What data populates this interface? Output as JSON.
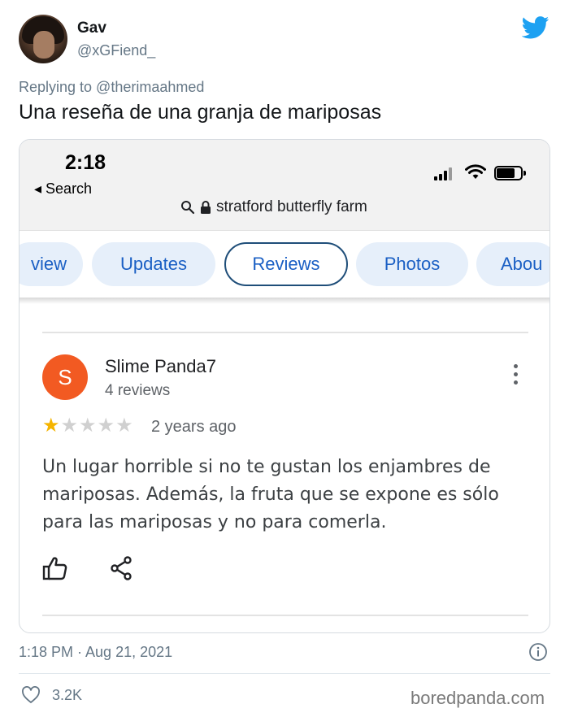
{
  "tweet": {
    "author_name": "Gav",
    "author_handle": "@xGFiend_",
    "replying_to": "Replying to @therimaahmed",
    "text": "Una reseña de una granja de mariposas",
    "timestamp": "1:18 PM · Aug 21, 2021",
    "likes": "3.2K"
  },
  "screenshot": {
    "status_time": "2:18",
    "back_label": "◂ Search",
    "url": "stratford butterfly farm",
    "tabs": [
      {
        "label": "view",
        "active": false
      },
      {
        "label": "Updates",
        "active": false
      },
      {
        "label": "Reviews",
        "active": true
      },
      {
        "label": "Photos",
        "active": false
      },
      {
        "label": "Abou",
        "active": false
      }
    ],
    "review": {
      "avatar_letter": "S",
      "reviewer_name": "Slime Panda7",
      "reviewer_count": "4 reviews",
      "rating": 1,
      "max_rating": 5,
      "date": "2 years ago",
      "text": "Un lugar horrible si no te gustan los enjambres de mariposas. Además, la fruta que se expone es sólo para las mariposas y no para comerla."
    }
  },
  "watermark": "boredpanda.com",
  "colors": {
    "twitter_blue": "#1da1f2",
    "chip_bg": "#e6effa",
    "chip_text": "#1a5fc4",
    "avatar_orange": "#f25a22",
    "star_gold": "#f5b400"
  },
  "icons": [
    "twitter-bird-icon",
    "signal-icon",
    "wifi-icon",
    "battery-icon",
    "search-icon",
    "lock-icon",
    "more-vert-icon",
    "star-icon",
    "thumbs-up-icon",
    "share-icon",
    "info-icon",
    "heart-icon"
  ]
}
